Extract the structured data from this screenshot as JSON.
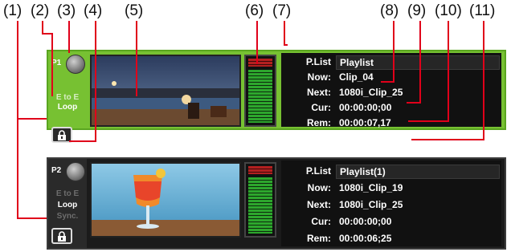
{
  "callouts": [
    "(1)",
    "(2)",
    "(3)",
    "(4)",
    "(5)",
    "(6)",
    "(7)",
    "(8)",
    "(9)",
    "(10)",
    "(11)"
  ],
  "players": [
    {
      "name": "P1",
      "modes": [
        {
          "label": "E to E",
          "active": false
        },
        {
          "label": "Loop",
          "active": true
        }
      ],
      "video": "night-pool-scene",
      "playlist_key": "P.List",
      "playlist_value": "Playlist",
      "now_key": "Now:",
      "now_value": "Clip_04",
      "next_key": "Next:",
      "next_value": "1080i_Clip_25",
      "cur_key": "Cur:",
      "cur_value": "00:00:00;00",
      "rem_key": "Rem:",
      "rem_value": "00:00:07,17",
      "meter_level": 0.85
    },
    {
      "name": "P2",
      "modes": [
        {
          "label": "E to E",
          "active": false
        },
        {
          "label": "Loop",
          "active": true
        },
        {
          "label": "Sync.",
          "active": false
        }
      ],
      "video": "cocktail-scene",
      "playlist_key": "P.List",
      "playlist_value": "Playlist(1)",
      "now_key": "Now:",
      "now_value": "1080i_Clip_19",
      "next_key": "Next:",
      "next_value": "1080i_Clip_25",
      "cur_key": "Cur:",
      "cur_value": "00:00:00;00",
      "rem_key": "Rem:",
      "rem_value": "00:00:06;25",
      "meter_level": 0.85
    }
  ],
  "colors": {
    "active_panel": "#77c132",
    "inactive_panel": "#1b1b1b",
    "leader": "#e0001a",
    "meter": "#2da72d"
  }
}
